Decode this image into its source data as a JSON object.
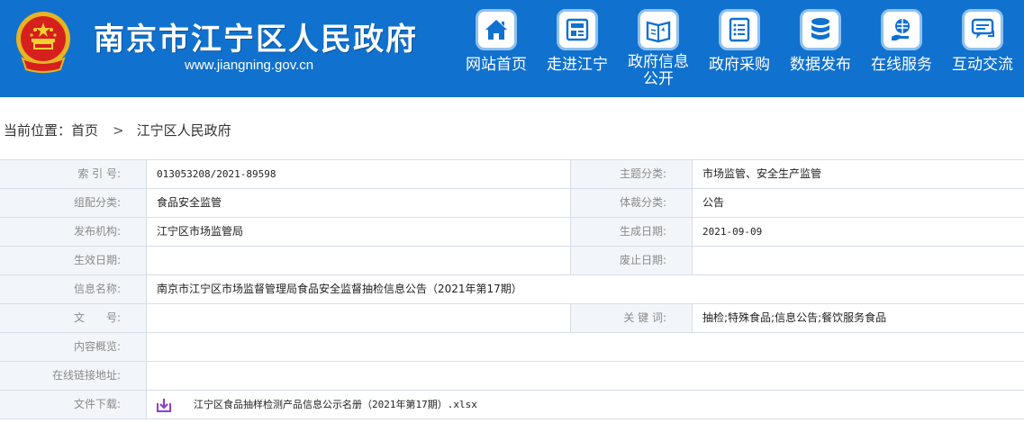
{
  "header": {
    "site_title": "南京市江宁区人民政府",
    "site_url": "www.jiangning.gov.cn",
    "bg_color": "#1071cf"
  },
  "nav": [
    {
      "label": "网站首页",
      "icon": "house-icon"
    },
    {
      "label": "走进江宁",
      "icon": "newspaper-icon"
    },
    {
      "label": "政府信息公开",
      "icon": "open-book-icon"
    },
    {
      "label": "政府采购",
      "icon": "list-icon"
    },
    {
      "label": "数据发布",
      "icon": "database-icon"
    },
    {
      "label": "在线服务",
      "icon": "globe-hand-icon"
    },
    {
      "label": "互动交流",
      "icon": "chat-bubbles-icon"
    }
  ],
  "breadcrumb": {
    "prefix": "当前位置：",
    "home": "首页",
    "separator": ">",
    "current": "江宁区人民政府"
  },
  "info": {
    "index_no_label": "索 引 号:",
    "index_no": "013053208/2021-89598",
    "topic_label": "主题分类:",
    "topic": "市场监管、安全生产监管",
    "org_cat_label": "组配分类:",
    "org_cat": "食品安全监管",
    "genre_label": "体裁分类:",
    "genre": "公告",
    "publisher_label": "发布机构:",
    "publisher": "江宁区市场监管局",
    "created_label": "生成日期:",
    "created": "2021-09-09",
    "effective_label": "生效日期:",
    "effective": "",
    "repeal_label": "废止日期:",
    "repeal": "",
    "name_label": "信息名称:",
    "name": "南京市江宁区市场监督管理局食品安全监督抽检信息公告（2021年第17期）",
    "doc_no_label": "文　　号:",
    "doc_no": "",
    "keywords_label": "关 键 词:",
    "keywords": "抽检;特殊食品;信息公告;餐饮服务食品",
    "overview_label": "内容概览:",
    "overview": "",
    "online_link_label": "在线链接地址:",
    "online_link": "",
    "download_label": "文件下载:",
    "download_file": "江宁区食品抽样检测产品信息公示名册（2021年第17期）.xlsx",
    "download_icon": "download-icon",
    "download_icon_color": "#8a3fd1"
  }
}
